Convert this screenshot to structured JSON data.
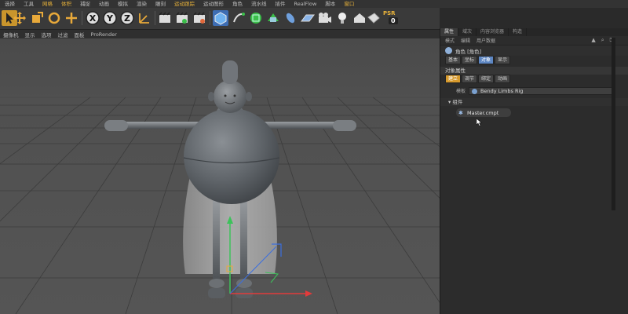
{
  "menubar": {
    "items": [
      {
        "label": "选择"
      },
      {
        "label": "工具"
      },
      {
        "label": "网格",
        "highlight": true
      },
      {
        "label": "体积",
        "highlight": true
      },
      {
        "label": "捕捉"
      },
      {
        "label": "动画"
      },
      {
        "label": "模拟"
      },
      {
        "label": "渲染"
      },
      {
        "label": "雕刻"
      },
      {
        "label": "运动跟踪",
        "highlight": true
      },
      {
        "label": "运动图形"
      },
      {
        "label": "角色"
      },
      {
        "label": "流水线"
      },
      {
        "label": "插件"
      },
      {
        "label": "RealFlow"
      },
      {
        "label": "脚本"
      },
      {
        "label": "窗口",
        "highlight": true
      }
    ]
  },
  "toolbar": {
    "psr_label": "PSR",
    "psr_value": "0",
    "axis_x": "X",
    "axis_y": "Y",
    "axis_z": "Z"
  },
  "viewport": {
    "menu": [
      "摄像机",
      "显示",
      "选项",
      "过滤",
      "面板",
      "ProRender"
    ]
  },
  "panel": {
    "tabs": [
      {
        "label": "属性",
        "active": true
      },
      {
        "label": "域次",
        "active": false
      },
      {
        "label": "内容浏览器",
        "active": false
      },
      {
        "label": "构造",
        "active": false
      }
    ],
    "modes": [
      "模式",
      "编辑",
      "用户数据"
    ],
    "object_title": "角色 [角色]",
    "subtabs": [
      {
        "label": "基本",
        "state": "normal"
      },
      {
        "label": "坐标",
        "state": "normal"
      },
      {
        "label": "对象",
        "state": "active"
      },
      {
        "label": "显示",
        "state": "normal"
      }
    ],
    "section_title": "对象属性",
    "build_tabs": [
      {
        "label": "建立",
        "state": "orange"
      },
      {
        "label": "调节",
        "state": "normal"
      },
      {
        "label": "绑定",
        "state": "normal"
      },
      {
        "label": "动画",
        "state": "normal"
      }
    ],
    "template_label": "模板",
    "template_value": "Bendy Limbs Rig",
    "components_label": "▾ 组件",
    "component_item": "Master.cmpt"
  },
  "colors": {
    "accent_orange": "#c9952c",
    "active_blue": "#5d86c2",
    "axis_red": "#e23b3b",
    "axis_green": "#3cc25a",
    "axis_blue": "#3b6fe0"
  }
}
